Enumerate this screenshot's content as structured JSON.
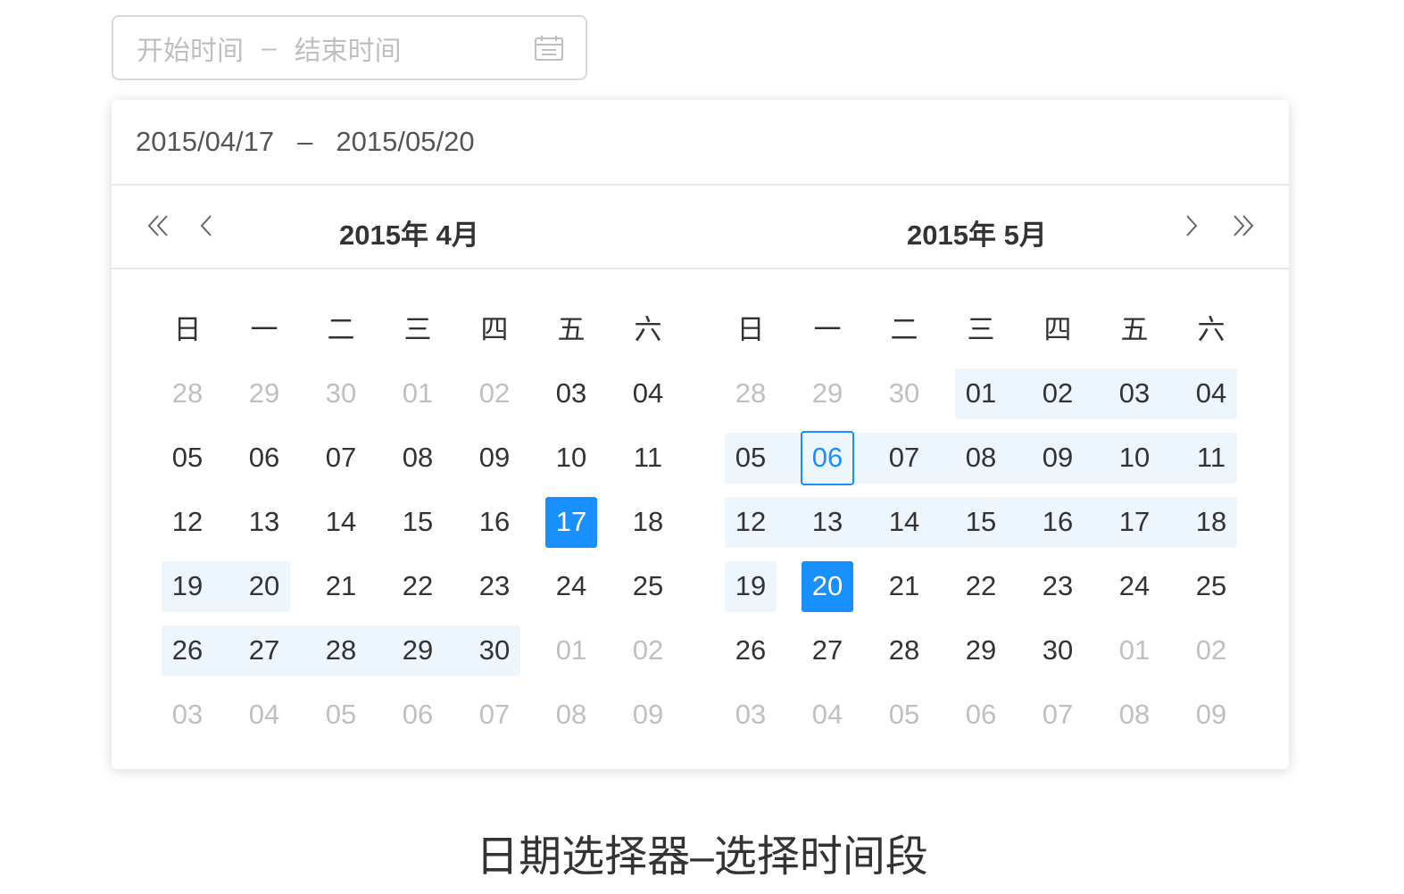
{
  "input": {
    "start_placeholder": "开始时间",
    "separator": "–",
    "end_placeholder": "结束时间",
    "icon": "calendar-icon"
  },
  "panel": {
    "selected_start": "2015/04/17",
    "separator": "–",
    "selected_end": "2015/05/20",
    "nav": {
      "prev_year_icon": "double-chevron-left-icon",
      "prev_month_icon": "chevron-left-icon",
      "next_month_icon": "chevron-right-icon",
      "next_year_icon": "double-chevron-right-icon"
    },
    "weekdays": [
      "日",
      "一",
      "二",
      "三",
      "四",
      "五",
      "六"
    ],
    "calendars": [
      {
        "title": "2015年 4月",
        "weeks": [
          [
            {
              "d": "28",
              "s": "muted"
            },
            {
              "d": "29",
              "s": "muted"
            },
            {
              "d": "30",
              "s": "muted"
            },
            {
              "d": "01",
              "s": "muted"
            },
            {
              "d": "02",
              "s": "muted"
            },
            {
              "d": "03"
            },
            {
              "d": "04"
            }
          ],
          [
            {
              "d": "05"
            },
            {
              "d": "06"
            },
            {
              "d": "07"
            },
            {
              "d": "08"
            },
            {
              "d": "09"
            },
            {
              "d": "10"
            },
            {
              "d": "11"
            }
          ],
          [
            {
              "d": "12"
            },
            {
              "d": "13"
            },
            {
              "d": "14"
            },
            {
              "d": "15"
            },
            {
              "d": "16"
            },
            {
              "d": "17",
              "s": "selected"
            },
            {
              "d": "18"
            }
          ],
          [
            {
              "d": "19",
              "s": "inrange"
            },
            {
              "d": "20",
              "s": "inrange"
            },
            {
              "d": "21"
            },
            {
              "d": "22"
            },
            {
              "d": "23"
            },
            {
              "d": "24"
            },
            {
              "d": "25"
            }
          ],
          [
            {
              "d": "26",
              "s": "inrange"
            },
            {
              "d": "27",
              "s": "inrange"
            },
            {
              "d": "28",
              "s": "inrange"
            },
            {
              "d": "29",
              "s": "inrange"
            },
            {
              "d": "30",
              "s": "inrange"
            },
            {
              "d": "01",
              "s": "muted"
            },
            {
              "d": "02",
              "s": "muted"
            }
          ],
          [
            {
              "d": "03",
              "s": "muted"
            },
            {
              "d": "04",
              "s": "muted"
            },
            {
              "d": "05",
              "s": "muted"
            },
            {
              "d": "06",
              "s": "muted"
            },
            {
              "d": "07",
              "s": "muted"
            },
            {
              "d": "08",
              "s": "muted"
            },
            {
              "d": "09",
              "s": "muted"
            }
          ]
        ]
      },
      {
        "title": "2015年 5月",
        "weeks": [
          [
            {
              "d": "28",
              "s": "muted"
            },
            {
              "d": "29",
              "s": "muted"
            },
            {
              "d": "30",
              "s": "muted"
            },
            {
              "d": "01",
              "s": "inrange"
            },
            {
              "d": "02",
              "s": "inrange"
            },
            {
              "d": "03",
              "s": "inrange"
            },
            {
              "d": "04",
              "s": "inrange"
            }
          ],
          [
            {
              "d": "05",
              "s": "inrange"
            },
            {
              "d": "06",
              "s": "today"
            },
            {
              "d": "07",
              "s": "inrange"
            },
            {
              "d": "08",
              "s": "inrange"
            },
            {
              "d": "09",
              "s": "inrange"
            },
            {
              "d": "10",
              "s": "inrange"
            },
            {
              "d": "11",
              "s": "inrange"
            }
          ],
          [
            {
              "d": "12",
              "s": "inrange"
            },
            {
              "d": "13",
              "s": "inrange"
            },
            {
              "d": "14",
              "s": "inrange"
            },
            {
              "d": "15",
              "s": "inrange"
            },
            {
              "d": "16",
              "s": "inrange"
            },
            {
              "d": "17",
              "s": "inrange"
            },
            {
              "d": "18",
              "s": "inrange"
            }
          ],
          [
            {
              "d": "19",
              "s": "inrange"
            },
            {
              "d": "20",
              "s": "selected"
            },
            {
              "d": "21"
            },
            {
              "d": "22"
            },
            {
              "d": "23"
            },
            {
              "d": "24"
            },
            {
              "d": "25"
            }
          ],
          [
            {
              "d": "26"
            },
            {
              "d": "27"
            },
            {
              "d": "28"
            },
            {
              "d": "29"
            },
            {
              "d": "30"
            },
            {
              "d": "01",
              "s": "muted"
            },
            {
              "d": "02",
              "s": "muted"
            }
          ],
          [
            {
              "d": "03",
              "s": "muted"
            },
            {
              "d": "04",
              "s": "muted"
            },
            {
              "d": "05",
              "s": "muted"
            },
            {
              "d": "06",
              "s": "muted"
            },
            {
              "d": "07",
              "s": "muted"
            },
            {
              "d": "08",
              "s": "muted"
            },
            {
              "d": "09",
              "s": "muted"
            }
          ]
        ]
      }
    ]
  },
  "caption": "日期选择器–选择时间段",
  "colors": {
    "accent": "#1890ff",
    "range_bg": "#edf6fd",
    "muted_text": "#c0c0c0",
    "placeholder": "#bfbfbf"
  }
}
